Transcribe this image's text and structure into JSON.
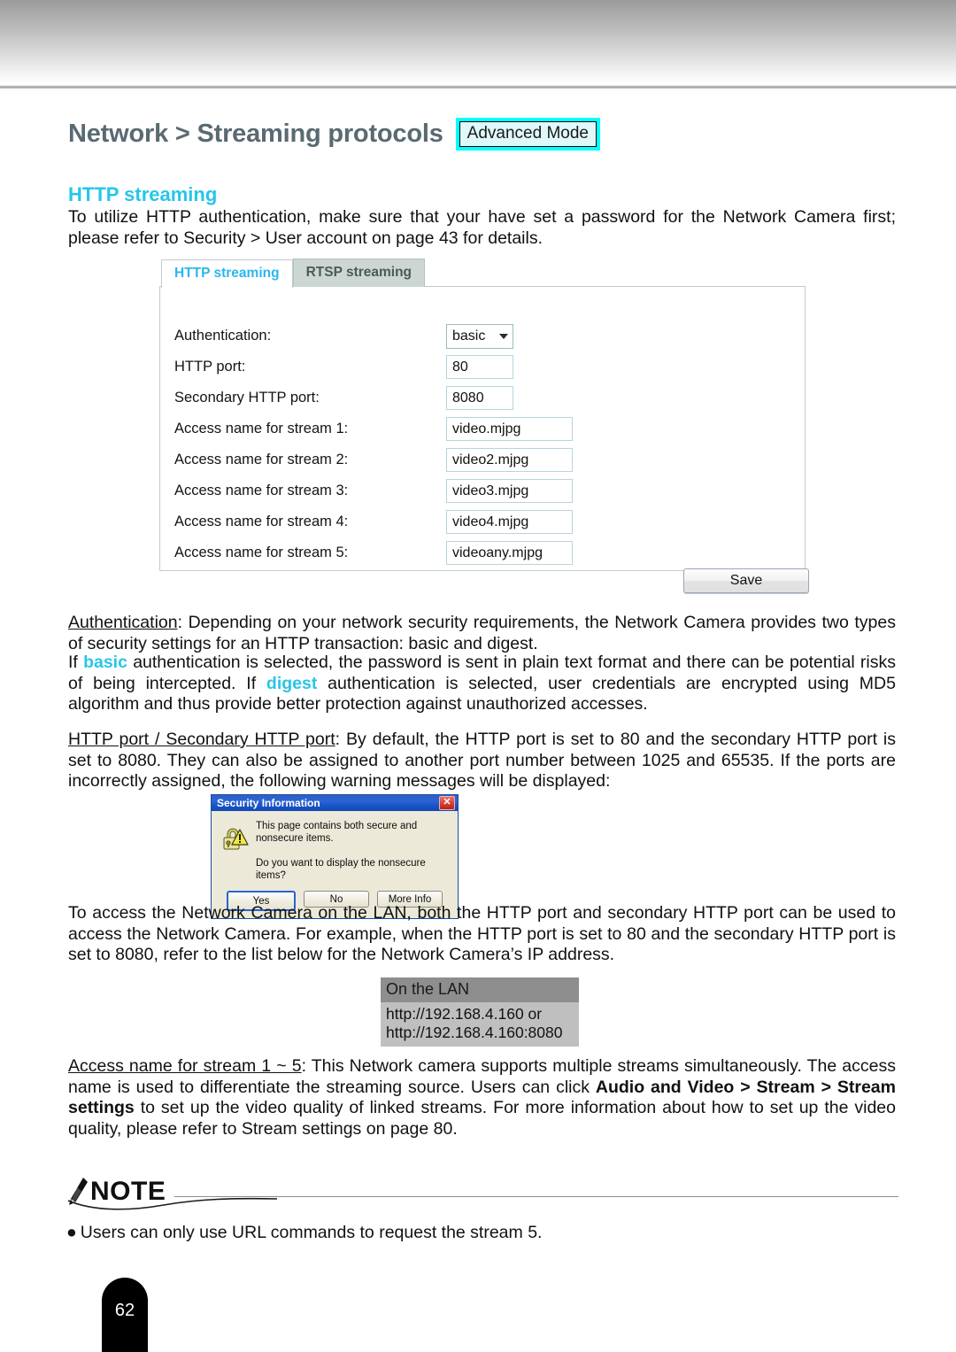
{
  "header": {
    "title": "Network > Streaming protocols",
    "badge": "Advanced Mode"
  },
  "section": {
    "heading": "HTTP streaming",
    "intro": "To utilize HTTP authentication, make sure that your have set a password for the Network Camera first; please refer to Security > User account on page 43 for details."
  },
  "camera_ui": {
    "tabs": [
      {
        "label": "HTTP streaming",
        "active": true
      },
      {
        "label": "RTSP streaming",
        "active": false
      }
    ],
    "fields": [
      {
        "label": "Authentication:",
        "value": "basic",
        "type": "select"
      },
      {
        "label": "HTTP port:",
        "value": "80",
        "type": "text-narrow"
      },
      {
        "label": "Secondary HTTP port:",
        "value": "8080",
        "type": "text-narrow"
      },
      {
        "label": "Access name for stream 1:",
        "value": "video.mjpg",
        "type": "text-wide"
      },
      {
        "label": "Access name for stream 2:",
        "value": "video2.mjpg",
        "type": "text-wide"
      },
      {
        "label": "Access name for stream 3:",
        "value": "video3.mjpg",
        "type": "text-wide"
      },
      {
        "label": "Access name for stream 4:",
        "value": "video4.mjpg",
        "type": "text-wide"
      },
      {
        "label": "Access name for stream 5:",
        "value": "videoany.mjpg",
        "type": "text-wide"
      }
    ],
    "save_label": "Save"
  },
  "body": {
    "auth_term": "Authentication",
    "auth_p1": ": Depending on your network security requirements, the Network Camera provides two types of security settings for an HTTP transaction: basic and digest.",
    "auth_p2_a": "If ",
    "auth_p2_basic": "basic",
    "auth_p2_b": " authentication is selected, the password is sent in plain text format and there can be potential risks of being intercepted. If ",
    "auth_p2_digest": "digest",
    "auth_p2_c": " authentication is selected, user credentials are encrypted using MD5 algorithm and thus provide better protection against unauthorized accesses.",
    "ports_term": "HTTP port / Secondary HTTP port",
    "ports_text": ": By default, the HTTP port is set to 80 and the secondary HTTP port is set to 8080. They can also be assigned to another port number between 1025 and 65535. If the ports are incorrectly assigned, the following warning messages will be displayed:",
    "lan_text": "To access the Network Camera on the LAN, both the HTTP port and secondary HTTP port can be used to access the Network Camera. For example, when the HTTP port is set to 80 and the secondary HTTP port is set to 8080, refer to the list below for the Network Camera’s IP address.",
    "access_term": "Access name for stream 1 ~ 5",
    "access_a": ": This Network camera supports multiple streams simultaneously. The access name is used to differentiate the streaming source. Users can click ",
    "access_bold1": "Audio and Video > Stream > Stream settings",
    "access_b": " to set up the video quality of linked streams. For more information about how to set up the video quality, please refer to Stream settings on page 80."
  },
  "dialog": {
    "title": "Security Information",
    "close_glyph": "✕",
    "line1": "This page contains both secure and nonsecure items.",
    "line2": "Do you want to display the nonsecure items?",
    "buttons": [
      "Yes",
      "No",
      "More Info"
    ]
  },
  "lan_table": {
    "header": "On the LAN",
    "row1": "http://192.168.4.160  or",
    "row2": "http://192.168.4.160:8080"
  },
  "note": {
    "label": "NOTE",
    "bullet": "●",
    "item": "Users can only use URL commands to request the stream 5."
  },
  "footer": {
    "page_number": "62"
  },
  "colors": {
    "title": "#5a6a72",
    "accent_cyan": "#26c6e8",
    "badge_border": "#00ffff",
    "tab_active_text": "#2bb6f0",
    "dialog_titlebar": "#1c56c8"
  }
}
